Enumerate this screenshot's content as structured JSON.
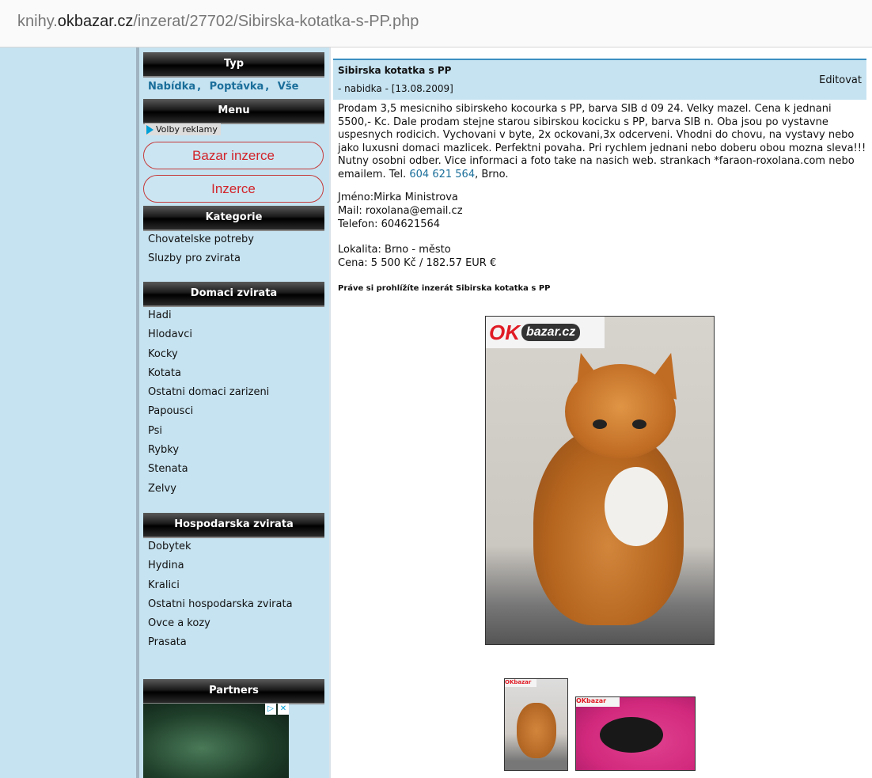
{
  "browser": {
    "url_prefix": "knihy.",
    "url_domain": "okbazar.cz",
    "url_path": "/inzerat/27702/Sibirska-kotatka-s-PP.php"
  },
  "sidebar": {
    "typ": {
      "header": "Typ",
      "links": [
        "Nabídka",
        "Poptávka",
        "Vše"
      ]
    },
    "menu": {
      "header": "Menu",
      "ad_options": "Volby reklamy",
      "buttons": [
        "Bazar inzerce",
        "Inzerce"
      ]
    },
    "kategorie": {
      "header": "Kategorie",
      "items": [
        "Chovatelske potreby",
        "Sluzby pro zvirata"
      ]
    },
    "domaci": {
      "header": "Domaci zvirata",
      "items": [
        "Hadi",
        "Hlodavci",
        "Kocky",
        "Kotata",
        "Ostatni domaci zarizeni",
        "Papousci",
        "Psi",
        "Rybky",
        "Stenata",
        "Zelvy"
      ]
    },
    "hospodarska": {
      "header": "Hospodarska zvirata",
      "items": [
        "Dobytek",
        "Hydina",
        "Kralici",
        "Ostatni hospodarska zvirata",
        "Ovce a kozy",
        "Prasata"
      ]
    },
    "partners": {
      "header": "Partners"
    }
  },
  "listing": {
    "title": "Sibirska kotatka s PP",
    "subtitle": "- nabidka - [13.08.2009]",
    "edit_label": "Editovat",
    "description_main": "Prodam 3,5 mesicniho sibirskeho kocourka s PP, barva SIB d 09 24. Velky mazel. Cena k jednani 5500,- Kc. Dale prodam stejne starou sibirskou kocicku s PP, barva SIB n. Oba jsou po vystavne uspesnych rodicich. Vychovani v byte, 2x ockovani,3x odcerveni. Vhodni do chovu, na vystavy nebo jako luxusni domaci mazlicek. Perfektni povaha. Pri rychlem jednani nebo doberu obou mozna sleva!!! Nutny osobni odber. Vice informaci a foto take na nasich web. strankach *faraon-roxolana.com nebo emailem. Tel. ",
    "phone_link": "604 621 564",
    "description_tail": ", Brno.",
    "name_line": "Jméno:Mirka Ministrova",
    "mail_line": "Mail: roxolana@email.cz",
    "phone_line": "Telefon: 604621564",
    "location_line": "Lokalita: Brno - město",
    "price_line": "Cena: 5 500 Kč / 182.57 EUR €",
    "viewing_note": "Práve si prohlížíte inzerát Sibirska kotatka s PP",
    "logo_ok": "OK",
    "logo_bazar": "bazar.cz",
    "thumb_logo": "OKbazar"
  }
}
